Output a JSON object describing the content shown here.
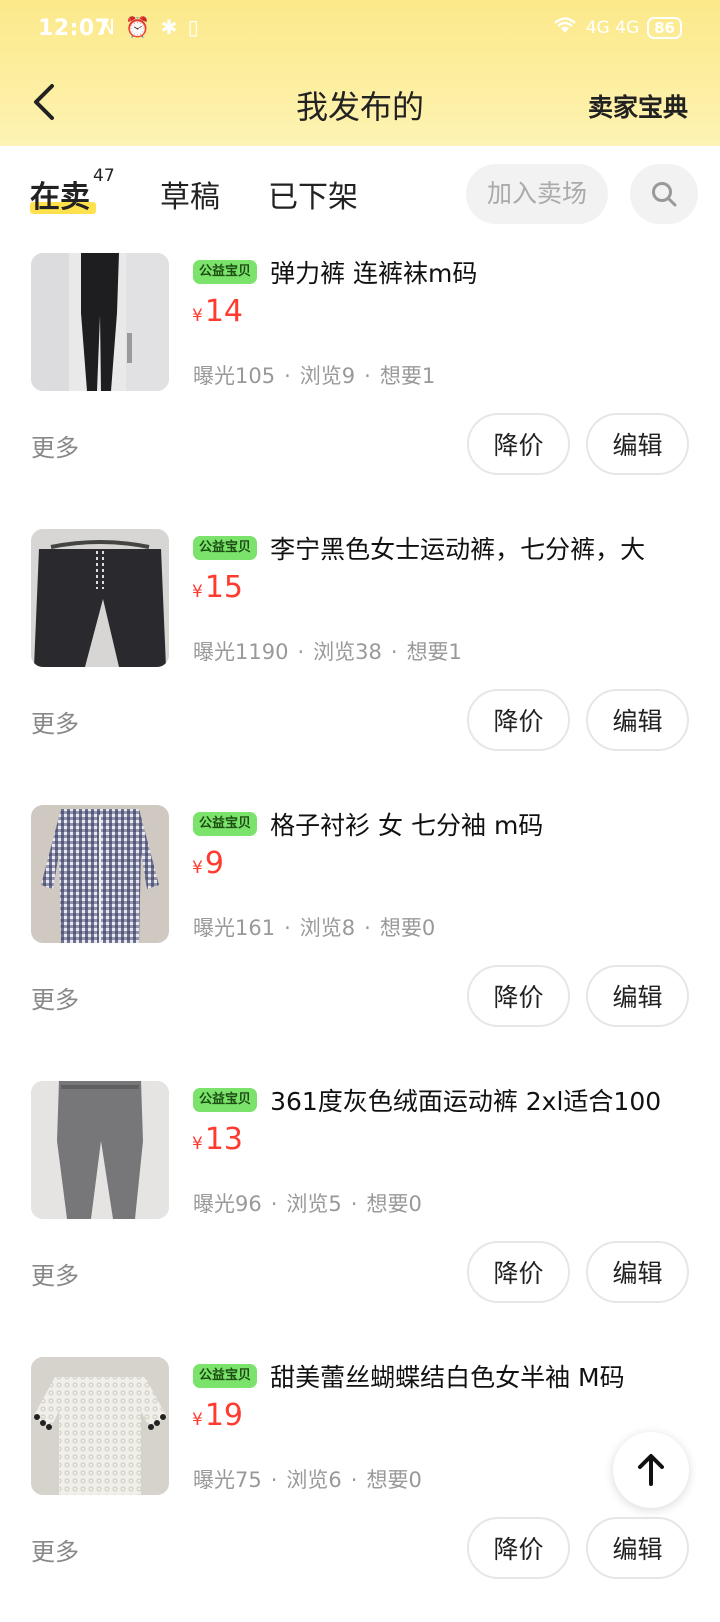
{
  "status_bar": {
    "time": "12:07",
    "left_icons": "N ⏰ ✱ ▯",
    "signal": "4G 4G",
    "battery": "86"
  },
  "header": {
    "title": "我发布的",
    "right_link": "卖家宝典"
  },
  "tabs": [
    {
      "label": "在卖",
      "count": "47",
      "active": true
    },
    {
      "label": "草稿"
    },
    {
      "label": "已下架"
    }
  ],
  "toolbar": {
    "join_label": "加入卖场"
  },
  "items": [
    {
      "badge": "公益宝贝",
      "title": "弹力裤 连裤袜m码",
      "currency": "¥",
      "price": "14",
      "exposure": "曝光105",
      "views": "浏览9",
      "wants": "想要1",
      "more": "更多",
      "reduce": "降价",
      "edit": "编辑"
    },
    {
      "badge": "公益宝贝",
      "title": "李宁黑色女士运动裤，七分裤，大",
      "currency": "¥",
      "price": "15",
      "exposure": "曝光1190",
      "views": "浏览38",
      "wants": "想要1",
      "more": "更多",
      "reduce": "降价",
      "edit": "编辑"
    },
    {
      "badge": "公益宝贝",
      "title": "格子衬衫 女 七分袖 m码",
      "currency": "¥",
      "price": "9",
      "exposure": "曝光161",
      "views": "浏览8",
      "wants": "想要0",
      "more": "更多",
      "reduce": "降价",
      "edit": "编辑"
    },
    {
      "badge": "公益宝贝",
      "title": "361度灰色绒面运动裤 2xl适合100",
      "currency": "¥",
      "price": "13",
      "exposure": "曝光96",
      "views": "浏览5",
      "wants": "想要0",
      "more": "更多",
      "reduce": "降价",
      "edit": "编辑"
    },
    {
      "badge": "公益宝贝",
      "title": "甜美蕾丝蝴蝶结白色女半袖 M码",
      "currency": "¥",
      "price": "19",
      "exposure": "曝光75",
      "views": "浏览6",
      "wants": "想要0",
      "more": "更多",
      "reduce": "降价",
      "edit": "编辑"
    }
  ],
  "colors": {
    "header_bg": "#fbe98a",
    "badge_bg": "#7be26b",
    "price": "#ff3b30",
    "tab_underline": "#ffe14d"
  },
  "icons": [
    "back-arrow-icon",
    "search-icon",
    "arrow-up-icon"
  ]
}
